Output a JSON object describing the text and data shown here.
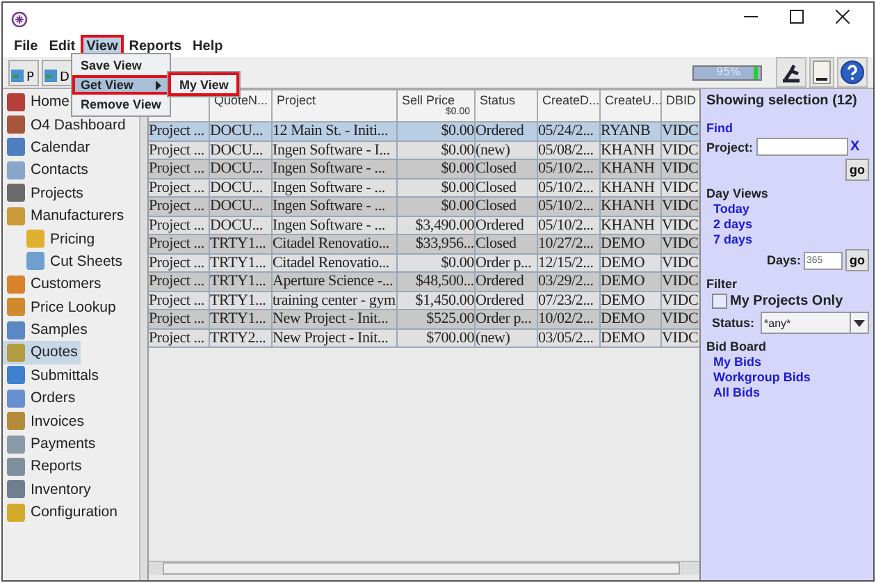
{
  "menu_bar": [
    {
      "label": "File",
      "open": false,
      "highlighted": false
    },
    {
      "label": "Edit",
      "open": false,
      "highlighted": false
    },
    {
      "label": "View",
      "open": true,
      "highlighted": true
    },
    {
      "label": "Reports",
      "open": false,
      "highlighted": false
    },
    {
      "label": "Help",
      "open": false,
      "highlighted": false
    }
  ],
  "view_menu": {
    "items": [
      {
        "label": "Save View",
        "selected": false,
        "has_submenu": false,
        "highlighted": false
      },
      {
        "label": "Get View",
        "selected": true,
        "has_submenu": true,
        "highlighted": true
      },
      {
        "label": "Remove View",
        "selected": false,
        "has_submenu": false,
        "highlighted": false
      }
    ],
    "submenu": {
      "items": [
        {
          "label": "My View",
          "highlighted": true
        }
      ]
    }
  },
  "toolbar": {
    "buttons": [
      "P",
      "D"
    ],
    "memory": {
      "reading": "95%",
      "level": 0.95
    }
  },
  "sidebar": {
    "items": [
      {
        "label": "Home",
        "selected": false
      },
      {
        "label": "O4 Dashboard",
        "selected": false
      },
      {
        "label": "Calendar",
        "selected": false
      },
      {
        "label": "Contacts",
        "selected": false
      },
      {
        "label": "Projects",
        "selected": false
      },
      {
        "label": "Manufacturers",
        "selected": false,
        "children": [
          {
            "label": "Pricing",
            "selected": false
          },
          {
            "label": "Cut Sheets",
            "selected": false
          }
        ]
      },
      {
        "label": "Customers",
        "selected": false
      },
      {
        "label": "Price Lookup",
        "selected": false
      },
      {
        "label": "Samples",
        "selected": false
      },
      {
        "label": "Quotes",
        "selected": true
      },
      {
        "label": "Submittals",
        "selected": false
      },
      {
        "label": "Orders",
        "selected": false
      },
      {
        "label": "Invoices",
        "selected": false
      },
      {
        "label": "Payments",
        "selected": false
      },
      {
        "label": "Reports",
        "selected": false
      },
      {
        "label": "Inventory",
        "selected": false
      },
      {
        "label": "Configuration",
        "selected": false
      }
    ]
  },
  "table": {
    "columns": [
      {},
      {
        "label": "QuoteN..."
      },
      {
        "label": "Project"
      },
      {
        "label": "Sell Price",
        "sub": "$0.00"
      },
      {
        "label": "Status"
      },
      {
        "label": "CreateD..."
      },
      {
        "label": "CreateU..."
      },
      {
        "label": "DBID"
      }
    ],
    "rows": [
      {
        "selected": true,
        "cells": [
          "Project ...",
          "DOCU...",
          "12 Main St. - Initi...",
          "$0.00",
          "Ordered",
          "05/24/2...",
          "RYANB",
          "VIDC"
        ]
      },
      {
        "selected": false,
        "cells": [
          "Project ...",
          "DOCU...",
          "Ingen Software - I...",
          "$0.00",
          "(new)",
          "05/08/2...",
          "KHANH",
          "VIDC"
        ]
      },
      {
        "selected": false,
        "cells": [
          "Project ...",
          "DOCU...",
          "Ingen Software - ...",
          "$0.00",
          "Closed",
          "05/10/2...",
          "KHANH",
          "VIDC"
        ]
      },
      {
        "selected": false,
        "cells": [
          "Project ...",
          "DOCU...",
          "Ingen Software - ...",
          "$0.00",
          "Closed",
          "05/10/2...",
          "KHANH",
          "VIDC"
        ]
      },
      {
        "selected": false,
        "cells": [
          "Project ...",
          "DOCU...",
          "Ingen Software - ...",
          "$0.00",
          "Closed",
          "05/10/2...",
          "KHANH",
          "VIDC"
        ]
      },
      {
        "selected": false,
        "cells": [
          "Project ...",
          "DOCU...",
          "Ingen Software - ...",
          "$3,490.00",
          "Ordered",
          "05/10/2...",
          "KHANH",
          "VIDC"
        ]
      },
      {
        "selected": false,
        "cells": [
          "Project ...",
          "TRTY1...",
          "Citadel Renovatio...",
          "$33,956...",
          "Closed",
          "10/27/2...",
          "DEMO",
          "VIDC"
        ]
      },
      {
        "selected": false,
        "cells": [
          "Project ...",
          "TRTY1...",
          "Citadel Renovatio...",
          "$0.00",
          "Order p...",
          "12/15/2...",
          "DEMO",
          "VIDC"
        ]
      },
      {
        "selected": false,
        "cells": [
          "Project ...",
          "TRTY1...",
          "Aperture Science -...",
          "$48,500...",
          "Ordered",
          "03/29/2...",
          "DEMO",
          "VIDC"
        ]
      },
      {
        "selected": false,
        "cells": [
          "Project ...",
          "TRTY1...",
          "training center - gym",
          "$1,450.00",
          "Ordered",
          "07/23/2...",
          "DEMO",
          "VIDC"
        ]
      },
      {
        "selected": false,
        "cells": [
          "Project ...",
          "TRTY1...",
          "New Project - Init...",
          "$525.00",
          "Order p...",
          "10/02/2...",
          "DEMO",
          "VIDC"
        ]
      },
      {
        "selected": false,
        "cells": [
          "Project ...",
          "TRTY2...",
          "New Project - Init...",
          "$700.00",
          "(new)",
          "03/05/2...",
          "DEMO",
          "VIDC"
        ]
      }
    ]
  },
  "side_panel": {
    "title": "Showing selection (12)",
    "find": {
      "heading": "Find",
      "label": "Project:",
      "clear": "X",
      "go": "go"
    },
    "day_views": {
      "heading": "Day Views",
      "links": [
        "Today",
        "2 days",
        "7 days"
      ],
      "days_label": "Days:",
      "days_value": "365",
      "go": "go"
    },
    "filter": {
      "heading": "Filter",
      "checkbox": {
        "label": "My Projects Only",
        "checked": false
      },
      "status_label": "Status:",
      "status_value": "*any*"
    },
    "bid_board": {
      "heading": "Bid Board",
      "links": [
        "My Bids",
        "Workgroup Bids",
        "All Bids"
      ]
    }
  }
}
